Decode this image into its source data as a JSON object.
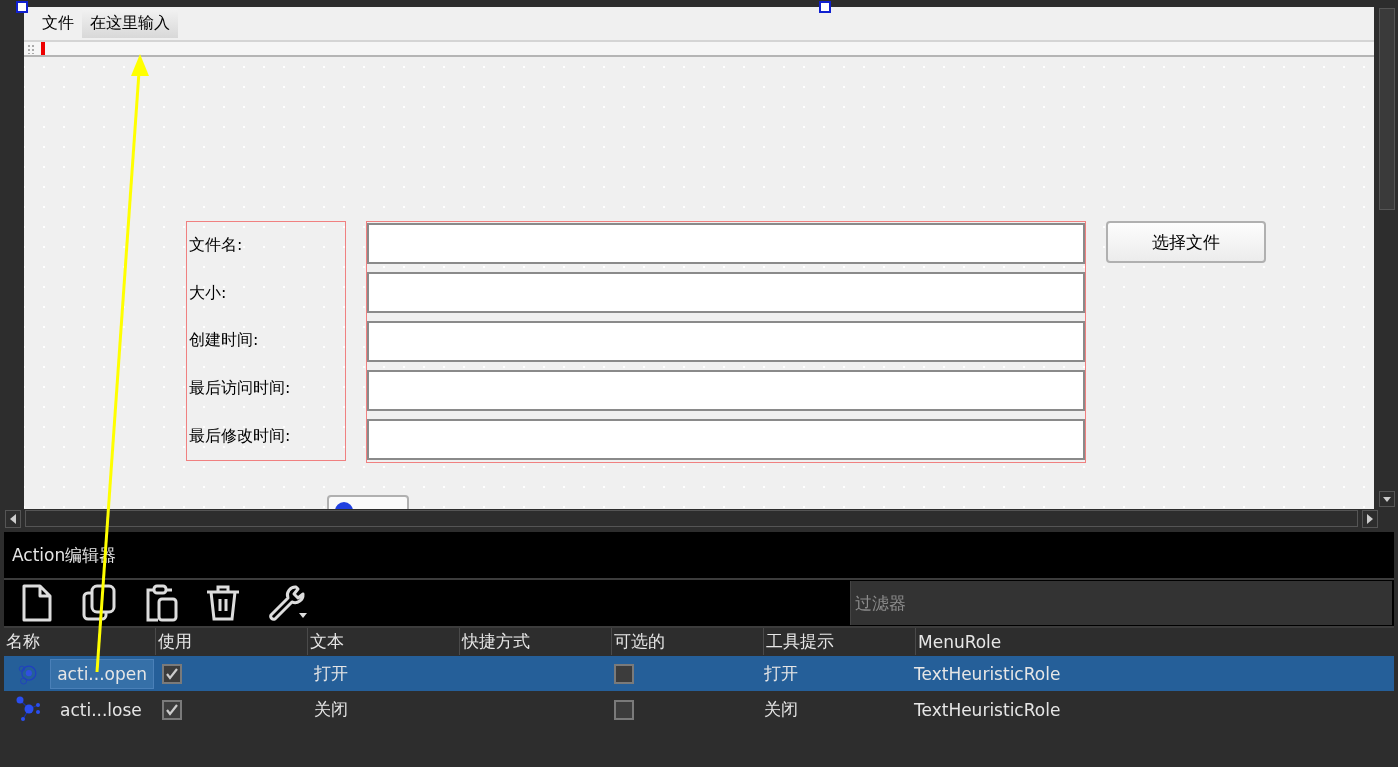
{
  "designer": {
    "menu_bar": [
      {
        "label": "文件",
        "kind": "menu"
      },
      {
        "label": "在这里输入",
        "kind": "placeholder"
      }
    ],
    "form": {
      "fields": [
        {
          "label": "文件名:"
        },
        {
          "label": "大小:"
        },
        {
          "label": "创建时间:"
        },
        {
          "label": "最后访问时间:"
        },
        {
          "label": "最后修改时间:"
        }
      ],
      "button": "选择文件"
    }
  },
  "action_editor": {
    "title": "Action编辑器",
    "filter": {
      "placeholder": "过滤器"
    },
    "table": {
      "columns": [
        "名称",
        "使用",
        "文本",
        "快捷方式",
        "可选的",
        "工具提示",
        "MenuRole"
      ],
      "rows": [
        {
          "name": "acti...open",
          "used": true,
          "text": "打开",
          "checkable": false,
          "tooltip": "打开",
          "menu_role": "TextHeuristicRole",
          "selected": true
        },
        {
          "name": "acti...lose",
          "used": true,
          "text": "关闭",
          "checkable": false,
          "tooltip": "关闭",
          "menu_role": "TextHeuristicRole",
          "selected": false
        }
      ]
    }
  }
}
